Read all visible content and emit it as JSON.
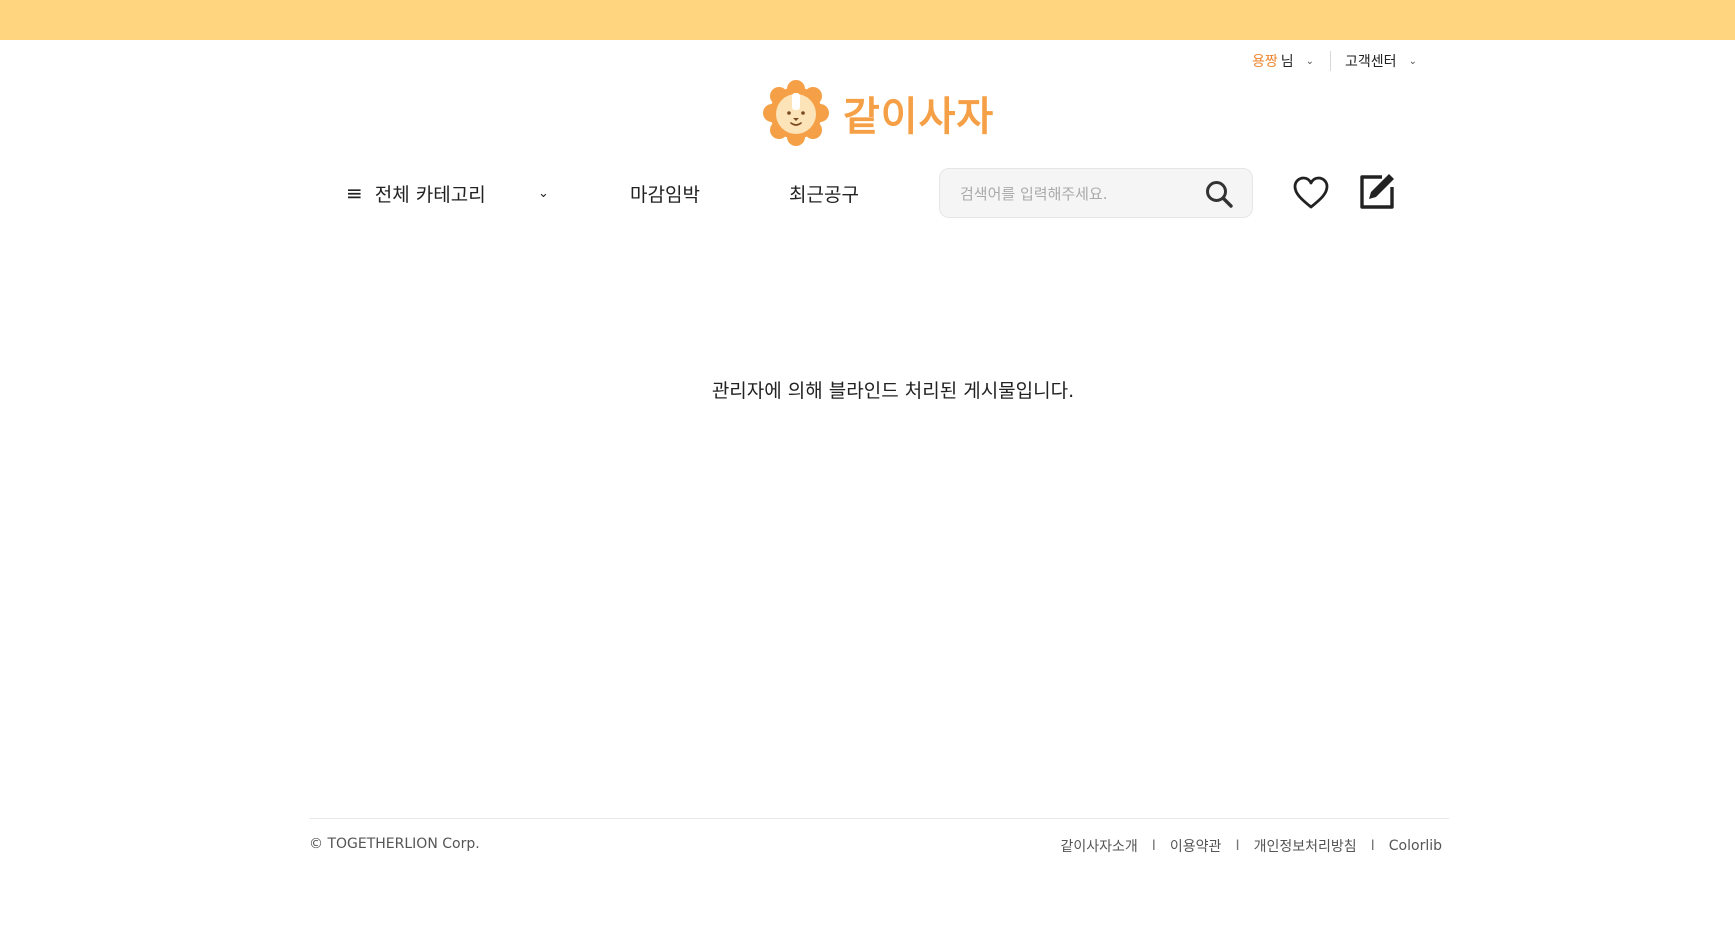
{
  "user_menu": {
    "username": "용짱",
    "suffix": "님",
    "support": "고객센터"
  },
  "logo": {
    "text": "같이사자"
  },
  "nav": {
    "category": "전체 카테고리",
    "deadline": "마감임박",
    "recent": "최근공구"
  },
  "search": {
    "placeholder": "검색어를 입력해주세요."
  },
  "main": {
    "notice": "관리자에 의해 블라인드 처리된 게시물입니다."
  },
  "footer": {
    "copyright": "© TOGETHERLION Corp.",
    "links": [
      "같이사자소개",
      "이용약관",
      "개인정보처리방침",
      "Colorlib"
    ],
    "separator": "I"
  },
  "colors": {
    "top_bar": "#ffd67f",
    "accent": "#f5a046",
    "username": "#f0862e"
  }
}
